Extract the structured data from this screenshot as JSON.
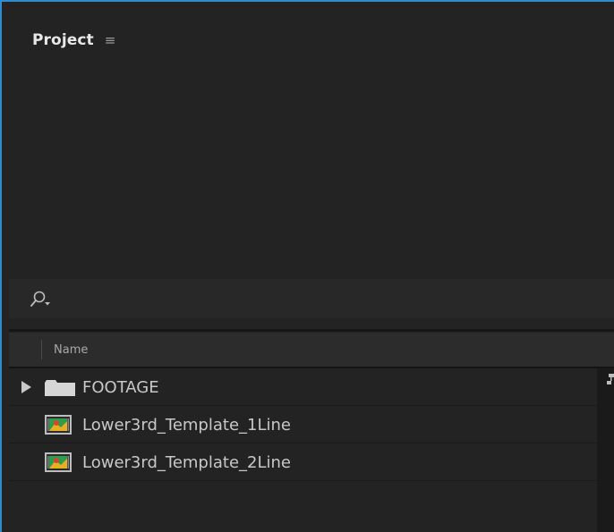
{
  "panel": {
    "title": "Project",
    "menu_icon": "hamburger-menu-icon"
  },
  "search": {
    "icon": "search-icon",
    "value": ""
  },
  "columns": [
    {
      "label": "Name"
    }
  ],
  "items": [
    {
      "label": "FOOTAGE",
      "type": "folder",
      "icon": "folder-icon",
      "expanded": false
    },
    {
      "label": "Lower3rd_Template_1Line",
      "type": "composition",
      "icon": "composition-icon"
    },
    {
      "label": "Lower3rd_Template_2Line",
      "type": "composition",
      "icon": "composition-icon"
    }
  ],
  "colors": {
    "accent_border": "#2f8cd0",
    "panel_bg": "#232323",
    "text": "#c8c8c8"
  }
}
